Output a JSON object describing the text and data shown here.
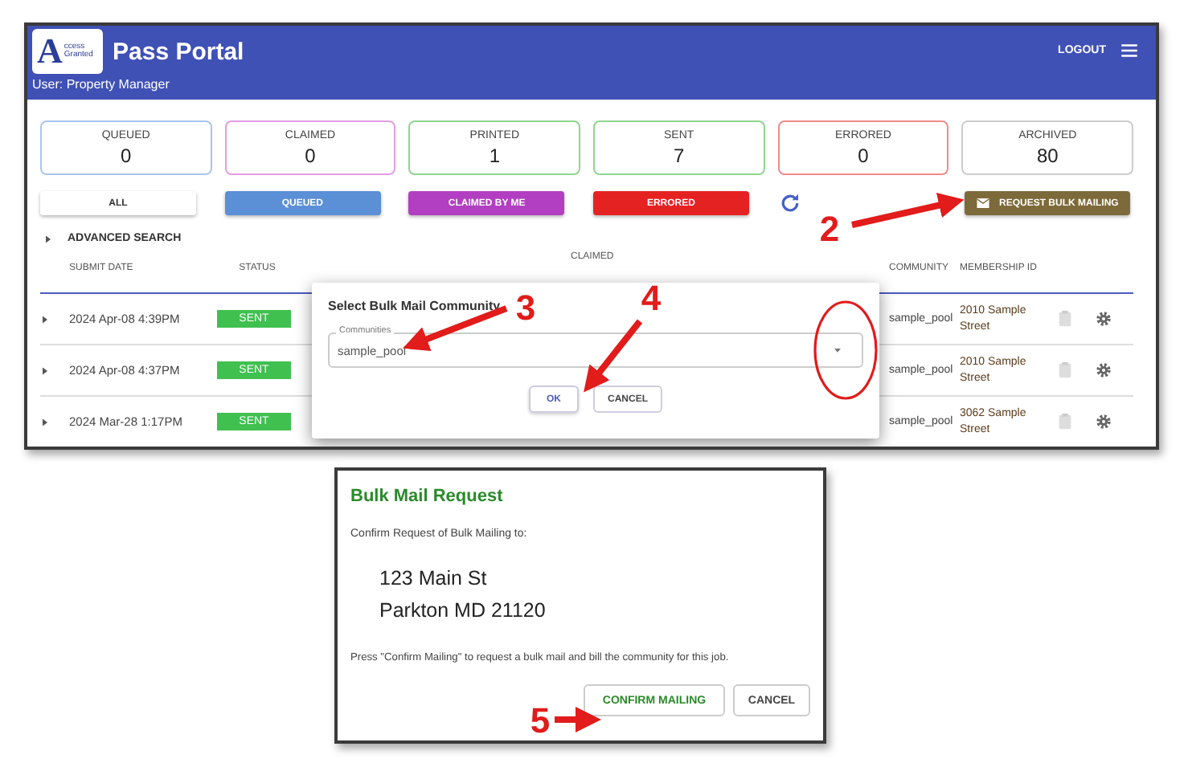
{
  "header": {
    "logo": {
      "letter": "A",
      "line1": "ccess",
      "line2": "Granted"
    },
    "title": "Pass Portal",
    "user": "User: Property Manager",
    "logout": "LOGOUT"
  },
  "stats": [
    {
      "label": "QUEUED",
      "value": "0",
      "color": "#a9c5ee"
    },
    {
      "label": "CLAIMED",
      "value": "0",
      "color": "#e29ce2"
    },
    {
      "label": "PRINTED",
      "value": "1",
      "color": "#8fd58f"
    },
    {
      "label": "SENT",
      "value": "7",
      "color": "#8fd58f"
    },
    {
      "label": "ERRORED",
      "value": "0",
      "color": "#f08a8a"
    },
    {
      "label": "ARCHIVED",
      "value": "80",
      "color": "#cccccc"
    }
  ],
  "filters": [
    {
      "label": "ALL",
      "color": "#ffffff"
    },
    {
      "label": "QUEUED",
      "color": "#5b8fd6"
    },
    {
      "label": "CLAIMED BY ME",
      "color": "#b23fc2"
    },
    {
      "label": "ERRORED",
      "color": "#e52222"
    }
  ],
  "request_button": "REQUEST BULK MAILING",
  "advanced_search": "ADVANCED SEARCH",
  "table": {
    "columns": [
      "SUBMIT DATE",
      "STATUS",
      "CLAIMED",
      "COMMUNITY",
      "MEMBERSHIP ID"
    ],
    "rows": [
      {
        "date": "2024 Apr-08 4:39PM",
        "status": "SENT",
        "community": "sample_pool",
        "membership": "2010 Sample Street"
      },
      {
        "date": "2024 Apr-08 4:37PM",
        "status": "SENT",
        "community": "sample_pool",
        "membership": "2010 Sample Street"
      },
      {
        "date": "2024 Mar-28 1:17PM",
        "status": "SENT",
        "community": "sample_pool",
        "membership": "3062 Sample Street"
      }
    ]
  },
  "select_dialog": {
    "title": "Select Bulk Mail Community",
    "field_label": "Communities",
    "value": "sample_pool",
    "buttons": [
      "OK",
      "CANCEL"
    ]
  },
  "request_dialog": {
    "title": "Bulk Mail Request",
    "prompt": "Confirm Request of Bulk Mailing to:",
    "address": [
      "123 Main St",
      "Parkton MD 21120"
    ],
    "note": "Press \"Confirm Mailing\" to request a bulk mail and bill the community for this job.",
    "buttons": [
      "CONFIRM MAILING",
      "CANCEL"
    ]
  },
  "annotations": [
    {
      "kind": "arrow",
      "label": "2"
    },
    {
      "kind": "circle"
    },
    {
      "kind": "arrow",
      "label": "3"
    },
    {
      "kind": "arrow",
      "label": "4"
    },
    {
      "kind": "arrow",
      "label": "5"
    }
  ]
}
